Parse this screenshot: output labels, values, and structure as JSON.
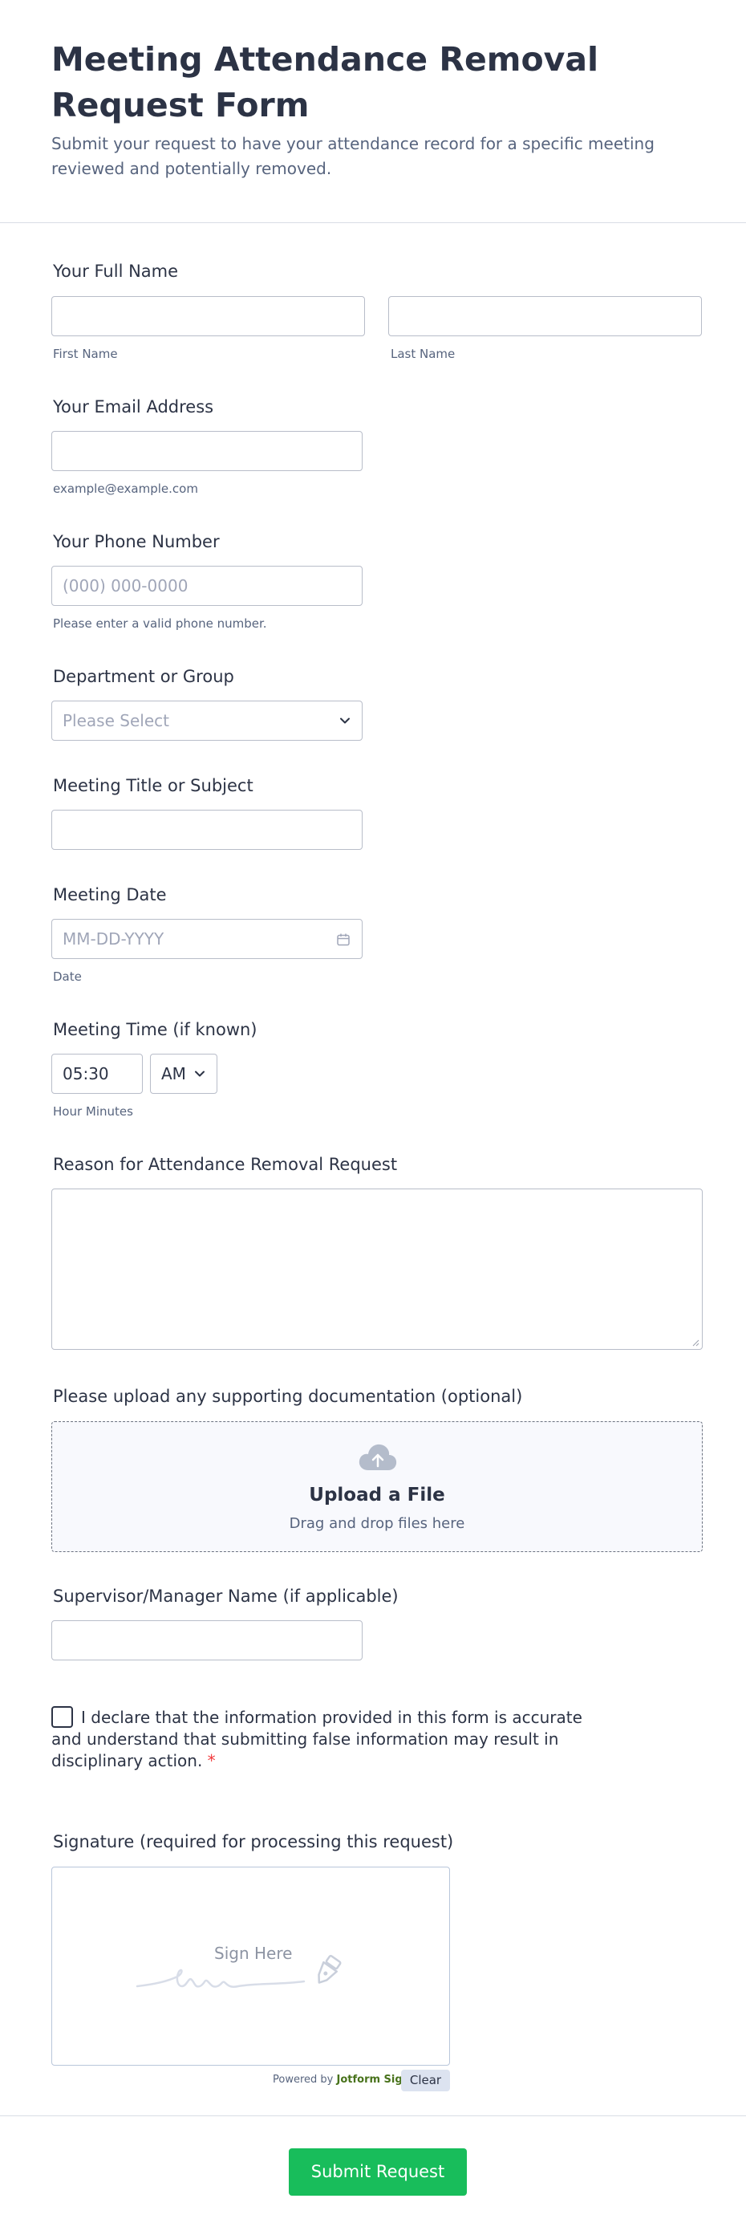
{
  "header": {
    "title": "Meeting Attendance Removal Request Form",
    "subtitle": "Submit your request to have your attendance record for a specific meeting reviewed and potentially removed."
  },
  "full_name": {
    "label": "Your Full Name",
    "first_sublabel": "First Name",
    "last_sublabel": "Last Name"
  },
  "email": {
    "label": "Your Email Address",
    "sublabel": "example@example.com"
  },
  "phone": {
    "label": "Your Phone Number",
    "placeholder": "(000) 000-0000",
    "sublabel": "Please enter a valid phone number."
  },
  "department": {
    "label": "Department or Group",
    "placeholder": "Please Select"
  },
  "meeting_title": {
    "label": "Meeting Title or Subject"
  },
  "meeting_date": {
    "label": "Meeting Date",
    "placeholder": "MM-DD-YYYY",
    "sublabel": "Date"
  },
  "meeting_time": {
    "label": "Meeting Time (if known)",
    "value": "05:30",
    "ampm": "AM",
    "sublabel": "Hour Minutes"
  },
  "reason": {
    "label": "Reason for Attendance Removal Request"
  },
  "upload": {
    "label": "Please upload any supporting documentation (optional)",
    "title": "Upload a File",
    "subtitle": "Drag and drop files here",
    "icon": "cloud-upload-icon"
  },
  "supervisor": {
    "label": "Supervisor/Manager Name (if applicable)"
  },
  "declaration": {
    "text": "I declare that the information provided in this form is accurate and understand that submitting false information may result in disciplinary action.",
    "required_mark": "*"
  },
  "signature": {
    "label": "Signature (required for processing this request)",
    "prompt": "Sign Here",
    "powered_by": "Powered by",
    "brand": "Jotform Sign",
    "clear_label": "Clear"
  },
  "submit": {
    "label": "Submit Request"
  },
  "colors": {
    "accent": "#18bd5b",
    "text": "#2c3345",
    "muted": "#57647e",
    "required": "#f23a3c"
  }
}
